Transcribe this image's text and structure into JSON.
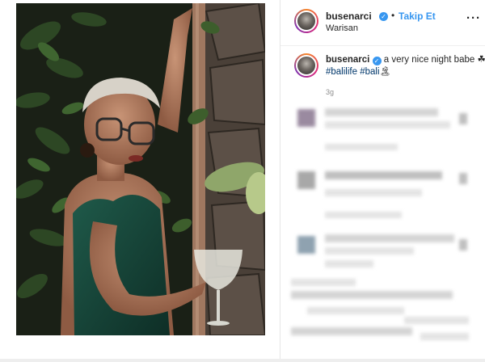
{
  "post": {
    "username": "busenarci",
    "verified_mark": "✓",
    "separator": "•",
    "follow_label": "Takip Et",
    "location": "Warisan",
    "more_label": "···"
  },
  "caption": {
    "username": "busenarci",
    "text": "a very nice night babe ☘",
    "hashtags": [
      "#balilife",
      "#bali"
    ],
    "hashtag_emoji": "🏝",
    "time": "3g"
  },
  "colors": {
    "accent": "#3897f0",
    "hashtag": "#00376b",
    "muted": "#8e8e8e"
  }
}
